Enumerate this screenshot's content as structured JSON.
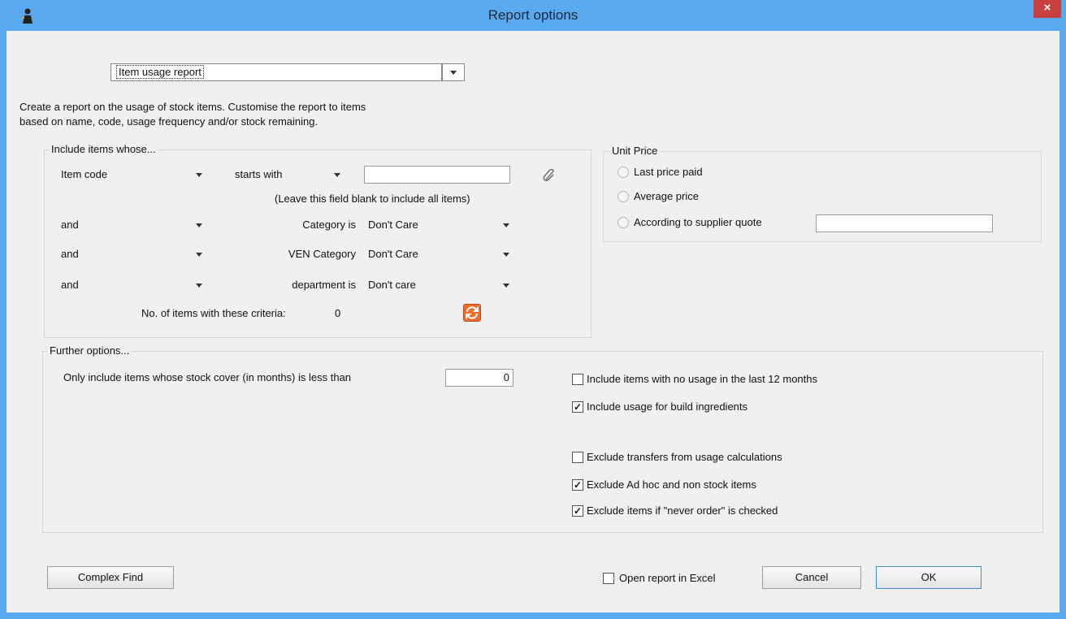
{
  "window": {
    "title": "Report options",
    "close_glyph": "×"
  },
  "report_select": {
    "value": "Item usage report"
  },
  "description": [
    "Create a report on the usage of stock items.  Customise the report to items",
    "based on name, code, usage frequency and/or stock remaining."
  ],
  "include_group": {
    "title": "Include items whose...",
    "field_select": "Item code",
    "operator_select": "starts with",
    "value_input": "",
    "hint": "(Leave this field blank to include all items)",
    "rows": [
      {
        "conj": "and",
        "label": "Category is",
        "value": "Don't Care"
      },
      {
        "conj": "and",
        "label": "VEN Category",
        "value": "Don't Care"
      },
      {
        "conj": "and",
        "label": "department is",
        "value": "Don't care"
      }
    ],
    "count_label": "No. of items with these criteria:",
    "count_value": "0"
  },
  "unit_price": {
    "title": "Unit Price",
    "options": [
      "Last price paid",
      "Average price",
      "According to supplier quote"
    ],
    "quote_input": ""
  },
  "further": {
    "title": "Further options...",
    "stock_cover_label": "Only include items whose stock cover (in months) is less than",
    "stock_cover_value": "0",
    "checkboxes": [
      {
        "label": "Include items with no usage in the last 12 months",
        "checked": false
      },
      {
        "label": "Include usage for build ingredients",
        "checked": true
      },
      {
        "label": "Exclude transfers from usage calculations",
        "checked": false
      },
      {
        "label": "Exclude Ad hoc and non stock items",
        "checked": true
      },
      {
        "label": "Exclude items if \"never order\" is checked",
        "checked": true
      }
    ]
  },
  "footer": {
    "complex_find": "Complex Find",
    "open_excel": "Open report in Excel",
    "open_excel_checked": false,
    "cancel": "Cancel",
    "ok": "OK"
  },
  "icons": {
    "app": "app-figure-icon",
    "attach": "paperclip-icon",
    "refresh": "refresh-icon",
    "close": "close-icon"
  },
  "colors": {
    "titlebar": "#5aa9ee",
    "close": "#c84040",
    "refresh": "#ef6d2d"
  }
}
